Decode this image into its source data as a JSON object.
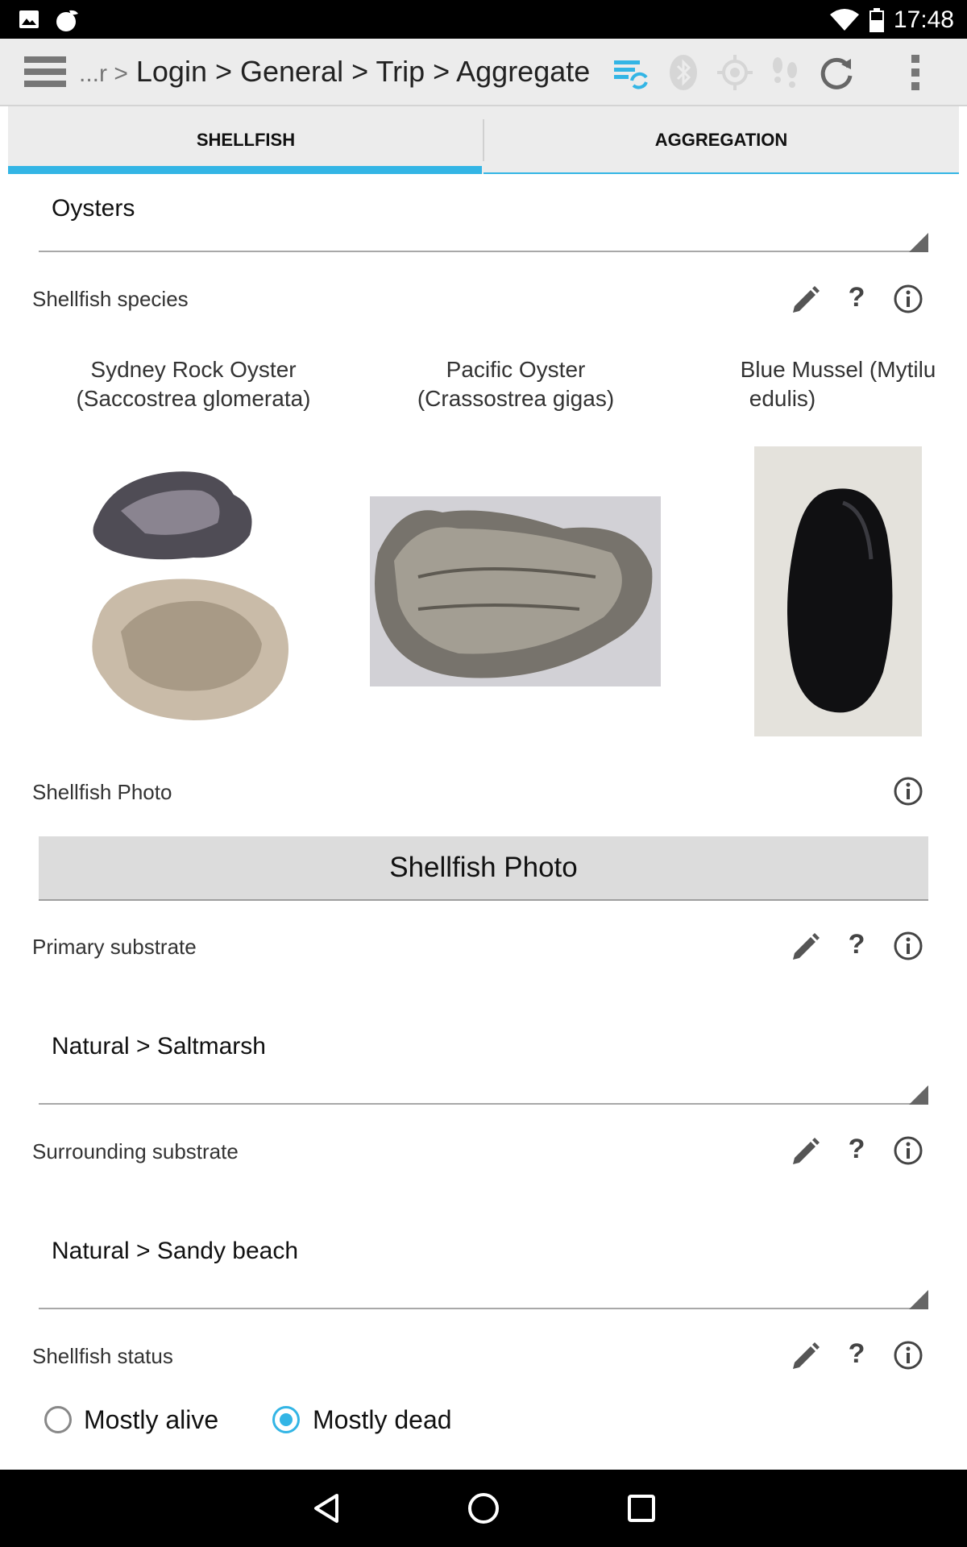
{
  "status_bar": {
    "time": "17:48"
  },
  "toolbar": {
    "breadcrumb_prefix": "...r >",
    "breadcrumb": "Login > General > Trip > Aggregate"
  },
  "tabs": [
    {
      "label": "SHELLFISH",
      "active": true
    },
    {
      "label": "AGGREGATION",
      "active": false
    }
  ],
  "form": {
    "category_value": "Oysters",
    "species": {
      "label": "Shellfish species",
      "options": [
        {
          "line1": "Sydney Rock Oyster",
          "line2": "(Saccostrea glomerata)",
          "image": "sydney-rock-oyster"
        },
        {
          "line1": "Pacific Oyster",
          "line2": "(Crassostrea gigas)",
          "image": "pacific-oyster"
        },
        {
          "line1": "Blue Mussel (Mytilu",
          "line2": "edulis)",
          "image": "blue-mussel"
        }
      ]
    },
    "photo": {
      "label": "Shellfish Photo",
      "button_label": "Shellfish Photo"
    },
    "primary_substrate": {
      "label": "Primary substrate",
      "value": "Natural > Saltmarsh"
    },
    "surrounding_substrate": {
      "label": "Surrounding substrate",
      "value": "Natural > Sandy beach"
    },
    "status": {
      "label": "Shellfish status",
      "options": [
        {
          "label": "Mostly alive",
          "selected": false
        },
        {
          "label": "Mostly dead",
          "selected": true
        }
      ]
    }
  },
  "colors": {
    "accent": "#33b5e5",
    "toolbar_bg": "#ececec"
  },
  "icons": [
    "hamburger-icon",
    "sync-settings-icon",
    "bluetooth-icon",
    "gps-icon",
    "footsteps-icon",
    "refresh-icon",
    "overflow-menu-icon",
    "pencil-icon",
    "help-icon",
    "info-icon"
  ]
}
